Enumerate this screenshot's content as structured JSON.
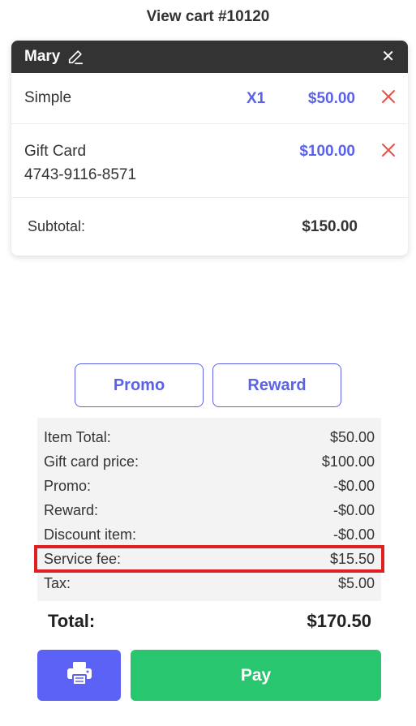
{
  "page": {
    "title": "View cart #10120"
  },
  "cart": {
    "customer_name": "Mary",
    "items": [
      {
        "name": "Simple",
        "quantity": "X1",
        "price": "$50.00"
      },
      {
        "name": "Gift Card",
        "code": "4743-9116-8571",
        "price": "$100.00"
      }
    ],
    "subtotal_label": "Subtotal:",
    "subtotal_value": "$150.00"
  },
  "buttons": {
    "promo": "Promo",
    "reward": "Reward",
    "pay": "Pay"
  },
  "summary": {
    "rows": [
      {
        "label": "Item Total:",
        "value": "$50.00"
      },
      {
        "label": "Gift card price:",
        "value": "$100.00"
      },
      {
        "label": "Promo:",
        "value": "-$0.00"
      },
      {
        "label": "Reward:",
        "value": "-$0.00"
      },
      {
        "label": "Discount item:",
        "value": "-$0.00"
      },
      {
        "label": "Service fee:",
        "value": "$15.50"
      },
      {
        "label": "Tax:",
        "value": "$5.00"
      }
    ],
    "total_label": "Total:",
    "total_value": "$170.50"
  },
  "icons": {
    "edit": "pencil-icon",
    "close": "close-icon",
    "remove": "remove-x-icon",
    "print": "printer-icon"
  },
  "colors": {
    "accent": "#5b62e8",
    "pay": "#28c76f",
    "remove": "#e8504a",
    "highlight": "#e02020",
    "header": "#333333"
  }
}
